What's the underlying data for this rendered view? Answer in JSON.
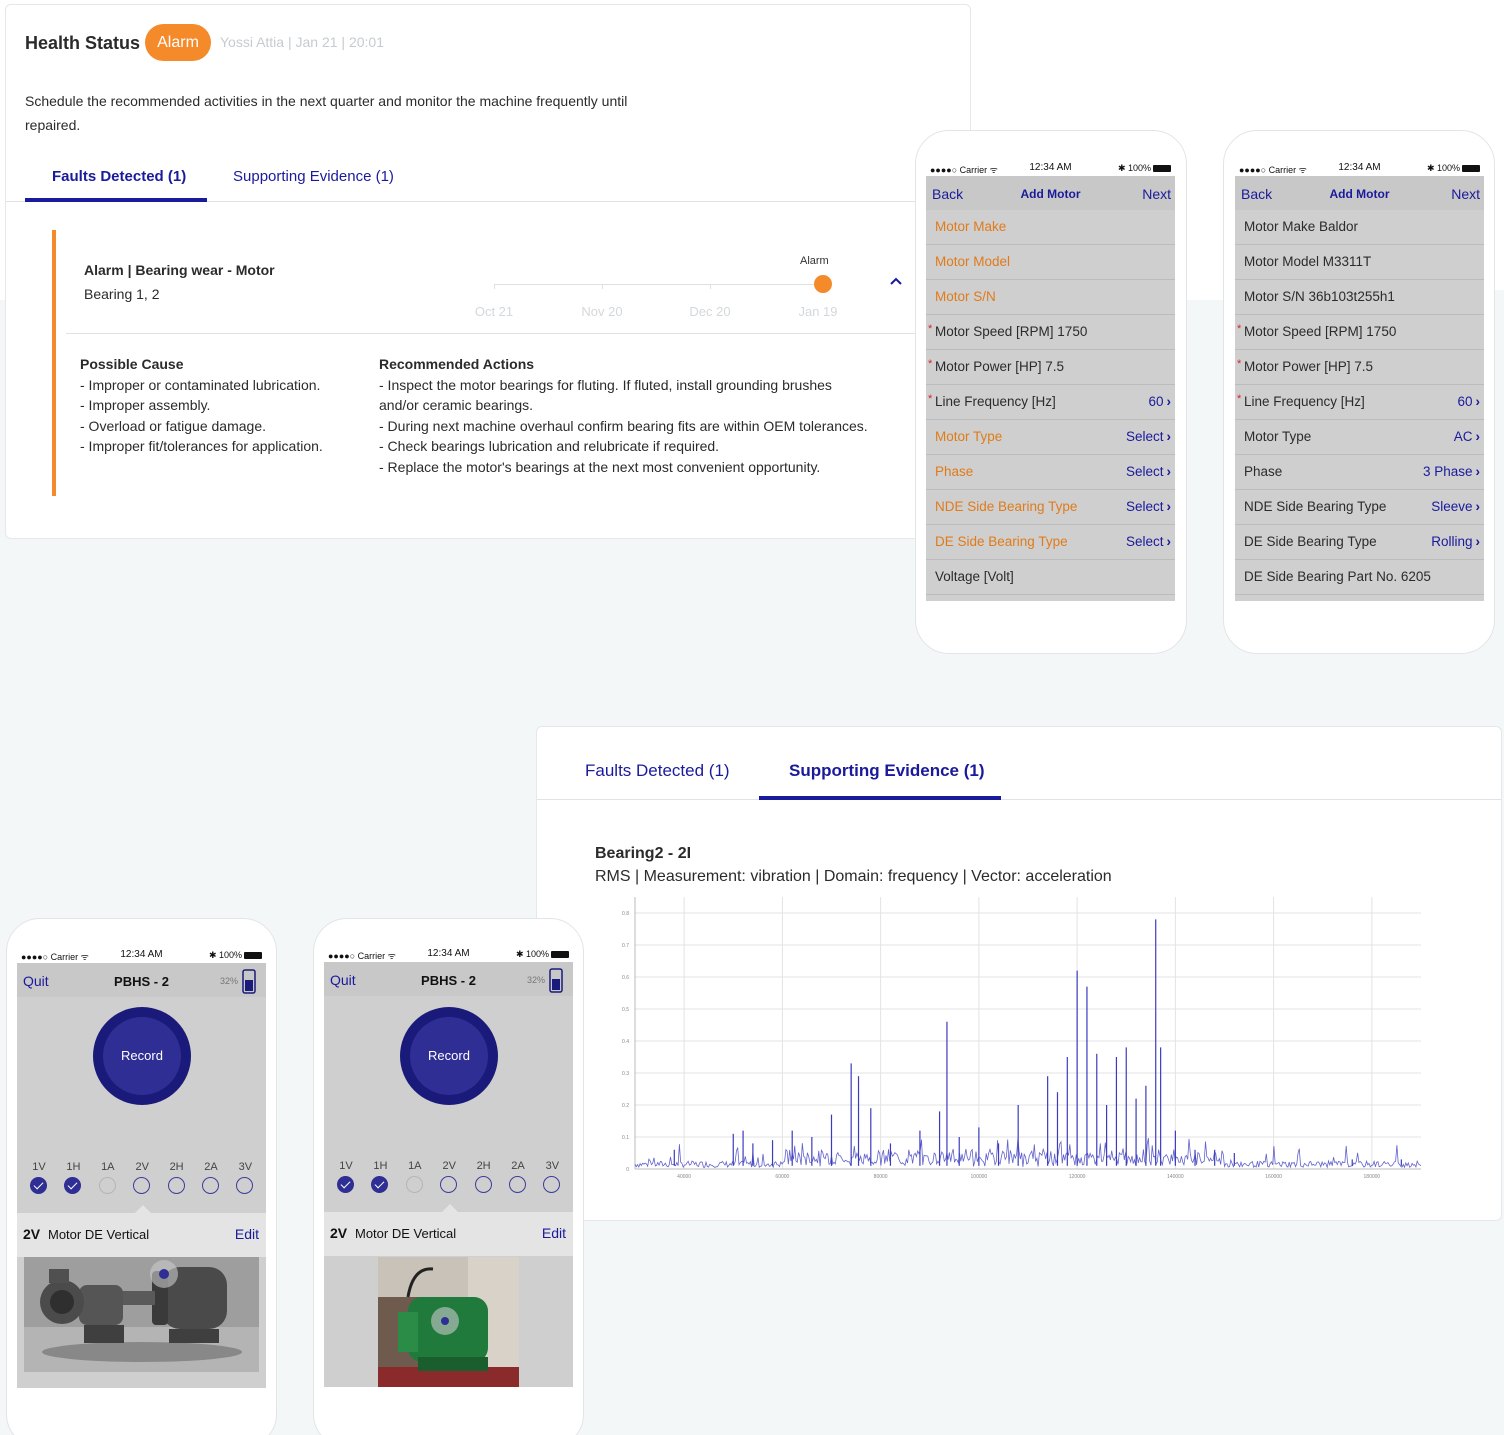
{
  "health": {
    "title": "Health Status",
    "badge": "Alarm",
    "meta": "Yossi Attia | Jan 21 | 20:01",
    "description": "Schedule the recommended activities in the next quarter and monitor the machine frequently until repaired.",
    "tabs": [
      "Faults Detected (1)",
      "Supporting Evidence (1)"
    ],
    "active_tab": 0,
    "fault": {
      "title": "Alarm | Bearing wear - Motor",
      "subtitle": "Bearing 1, 2",
      "timeline_labels": [
        "Oct 21",
        "Nov 20",
        "Dec 20",
        "Jan 19"
      ],
      "timeline_marker": "Alarm",
      "cause_heading": "Possible Cause",
      "causes": [
        "- Improper or contaminated lubrication.",
        "- Improper assembly.",
        "- Overload or fatigue damage.",
        "- Improper fit/tolerances for application."
      ],
      "actions_heading": "Recommended Actions",
      "actions": [
        "- Inspect the motor bearings for fluting. If fluted, install grounding brushes",
        "and/or ceramic bearings.",
        "- During next machine overhaul confirm bearing fits are within OEM tolerances.",
        "- Check bearings lubrication and relubricate if required.",
        "- Replace the motor's bearings at the next most convenient opportunity."
      ]
    }
  },
  "status_bar": {
    "carrier": "●●●●○ Carrier ᯤ",
    "time": "12:34 AM",
    "battery": "✱ 100%"
  },
  "add_motor_empty": {
    "back": "Back",
    "title": "Add Motor",
    "next": "Next",
    "rows": [
      {
        "label": "Motor Make",
        "value": "",
        "required": false,
        "style": "orange"
      },
      {
        "label": "Motor Model",
        "value": "",
        "required": false,
        "style": "orange"
      },
      {
        "label": "Motor S/N",
        "value": "",
        "required": false,
        "style": "orange"
      },
      {
        "label": "Motor Speed [RPM] 1750",
        "value": "",
        "required": true,
        "style": "dark"
      },
      {
        "label": "Motor Power [HP] 7.5",
        "value": "",
        "required": true,
        "style": "dark"
      },
      {
        "label": "Line Frequency [Hz]",
        "value": "60",
        "required": true,
        "style": "dark"
      },
      {
        "label": "Motor Type",
        "value": "Select",
        "required": false,
        "style": "orange"
      },
      {
        "label": "Phase",
        "value": "Select",
        "required": false,
        "style": "orange"
      },
      {
        "label": "NDE Side Bearing Type",
        "value": "Select",
        "required": false,
        "style": "orange"
      },
      {
        "label": "DE Side Bearing Type",
        "value": "Select",
        "required": false,
        "style": "orange"
      },
      {
        "label": "Voltage [Volt]",
        "value": "",
        "required": false,
        "style": "dark"
      }
    ]
  },
  "add_motor_filled": {
    "back": "Back",
    "title": "Add Motor",
    "next": "Next",
    "rows": [
      {
        "label": "Motor Make Baldor",
        "value": "",
        "required": false,
        "style": "dark"
      },
      {
        "label": "Motor Model M3311T",
        "value": "",
        "required": false,
        "style": "dark"
      },
      {
        "label": "Motor S/N 36b103t255h1",
        "value": "",
        "required": false,
        "style": "dark"
      },
      {
        "label": "Motor Speed [RPM] 1750",
        "value": "",
        "required": true,
        "style": "dark"
      },
      {
        "label": "Motor Power [HP] 7.5",
        "value": "",
        "required": true,
        "style": "dark"
      },
      {
        "label": "Line Frequency [Hz]",
        "value": "60",
        "required": true,
        "style": "dark"
      },
      {
        "label": "Motor Type",
        "value": "AC",
        "required": false,
        "style": "dark"
      },
      {
        "label": "Phase",
        "value": "3 Phase",
        "required": false,
        "style": "dark"
      },
      {
        "label": "NDE Side Bearing Type",
        "value": "Sleeve",
        "required": false,
        "style": "dark"
      },
      {
        "label": "DE Side Bearing Type",
        "value": "Rolling",
        "required": false,
        "style": "dark"
      },
      {
        "label": "DE Side Bearing Part No. 6205",
        "value": "",
        "required": false,
        "style": "dark"
      }
    ]
  },
  "record": {
    "quit": "Quit",
    "title": "PBHS - 2",
    "battery_pct": "32%",
    "button": "Record",
    "channels": [
      "1V",
      "1H",
      "1A",
      "2V",
      "2H",
      "2A",
      "3V"
    ],
    "channel_states": [
      "done",
      "done",
      "disabled",
      "open",
      "open",
      "open",
      "open"
    ],
    "selected_code": "2V",
    "selected_name": "Motor DE Vertical",
    "edit": "Edit"
  },
  "evidence": {
    "tabs": [
      "Faults Detected (1)",
      "Supporting Evidence (1)"
    ],
    "active_tab": 1,
    "title": "Bearing2 - 2I",
    "subtitle": "RMS | Measurement: vibration | Domain: frequency | Vector: acceleration"
  },
  "chart_data": {
    "type": "line",
    "title": "Bearing2 - 2I",
    "xlabel": "",
    "ylabel": "",
    "x_ticks": [
      "40000",
      "60000",
      "80000",
      "100000",
      "120000",
      "140000",
      "160000",
      "180000"
    ],
    "y_ticks": [
      "0",
      "0.1",
      "0.2",
      "0.3",
      "0.4",
      "0.5",
      "0.6",
      "0.7",
      "0.8"
    ],
    "xlim": [
      30000,
      190000
    ],
    "ylim": [
      0,
      0.85
    ],
    "grid": true,
    "color": "#3b3bbf",
    "peaks": [
      {
        "x": 38000,
        "y": 0.06
      },
      {
        "x": 50000,
        "y": 0.11
      },
      {
        "x": 52000,
        "y": 0.12
      },
      {
        "x": 54000,
        "y": 0.08
      },
      {
        "x": 58000,
        "y": 0.09
      },
      {
        "x": 62000,
        "y": 0.12
      },
      {
        "x": 66000,
        "y": 0.1
      },
      {
        "x": 70000,
        "y": 0.17
      },
      {
        "x": 74000,
        "y": 0.33
      },
      {
        "x": 75500,
        "y": 0.29
      },
      {
        "x": 78000,
        "y": 0.19
      },
      {
        "x": 82000,
        "y": 0.08
      },
      {
        "x": 88000,
        "y": 0.12
      },
      {
        "x": 92000,
        "y": 0.18
      },
      {
        "x": 93500,
        "y": 0.46
      },
      {
        "x": 96000,
        "y": 0.1
      },
      {
        "x": 100000,
        "y": 0.13
      },
      {
        "x": 104000,
        "y": 0.08
      },
      {
        "x": 108000,
        "y": 0.2
      },
      {
        "x": 114000,
        "y": 0.29
      },
      {
        "x": 116000,
        "y": 0.24
      },
      {
        "x": 118000,
        "y": 0.35
      },
      {
        "x": 120000,
        "y": 0.62
      },
      {
        "x": 122000,
        "y": 0.57
      },
      {
        "x": 124000,
        "y": 0.36
      },
      {
        "x": 126000,
        "y": 0.2
      },
      {
        "x": 128000,
        "y": 0.35
      },
      {
        "x": 130000,
        "y": 0.38
      },
      {
        "x": 132000,
        "y": 0.22
      },
      {
        "x": 134000,
        "y": 0.26
      },
      {
        "x": 136000,
        "y": 0.78
      },
      {
        "x": 137000,
        "y": 0.38
      },
      {
        "x": 140000,
        "y": 0.12
      },
      {
        "x": 144000,
        "y": 0.06
      },
      {
        "x": 148000,
        "y": 0.06
      },
      {
        "x": 152000,
        "y": 0.05
      },
      {
        "x": 176000,
        "y": 0.03
      },
      {
        "x": 186000,
        "y": 0.03
      }
    ]
  }
}
